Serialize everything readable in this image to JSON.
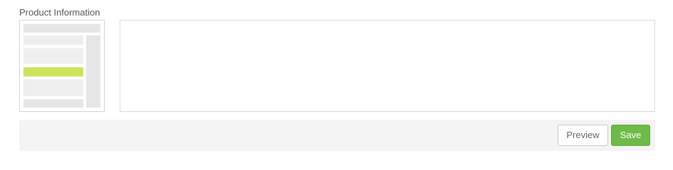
{
  "section": {
    "title": "Product Information"
  },
  "editor": {
    "value": "",
    "placeholder": ""
  },
  "actions": {
    "preview_label": "Preview",
    "save_label": "Save"
  },
  "colors": {
    "accent_green": "#6fbb4a",
    "layout_highlight": "#cfe35a",
    "action_bar_bg": "#f4f4f4"
  },
  "icons": {
    "layout_thumbnail": "layout-thumbnail-icon"
  }
}
